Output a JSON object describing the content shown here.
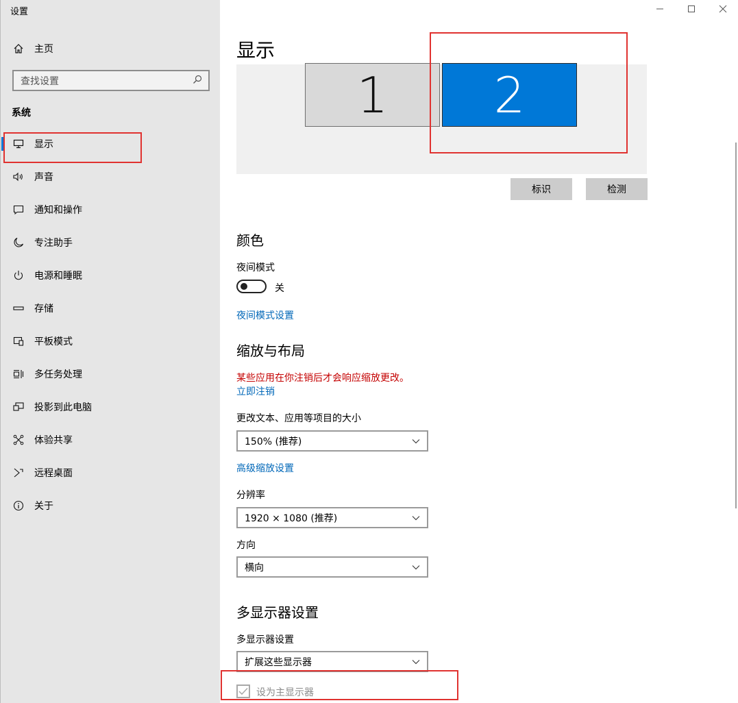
{
  "window": {
    "title": "设置",
    "controls": {
      "minimize": "–",
      "maximize": "☐",
      "close": "✕"
    }
  },
  "sidebar": {
    "home_label": "主页",
    "search_placeholder": "查找设置",
    "section_title": "系统",
    "items": [
      {
        "label": "显示",
        "icon": "monitor-icon",
        "active": true
      },
      {
        "label": "声音",
        "icon": "speaker-icon"
      },
      {
        "label": "通知和操作",
        "icon": "message-icon"
      },
      {
        "label": "专注助手",
        "icon": "moon-icon"
      },
      {
        "label": "电源和睡眠",
        "icon": "power-icon"
      },
      {
        "label": "存储",
        "icon": "storage-icon"
      },
      {
        "label": "平板模式",
        "icon": "tablet-icon"
      },
      {
        "label": "多任务处理",
        "icon": "multitask-icon"
      },
      {
        "label": "投影到此电脑",
        "icon": "project-icon"
      },
      {
        "label": "体验共享",
        "icon": "share-icon"
      },
      {
        "label": "远程桌面",
        "icon": "remote-icon"
      },
      {
        "label": "关于",
        "icon": "info-icon"
      }
    ]
  },
  "main": {
    "title": "显示",
    "monitors": [
      "1",
      "2"
    ],
    "selected_monitor": "2",
    "identify_button": "标识",
    "detect_button": "检测",
    "color_heading": "颜色",
    "night_mode_label": "夜间模式",
    "night_mode_state": "关",
    "night_mode_link": "夜间模式设置",
    "scale_heading": "缩放与布局",
    "scale_warning": "某些应用在你注销后才会响应缩放更改。",
    "sign_out_link": "立即注销",
    "text_size_label": "更改文本、应用等项目的大小",
    "text_size_value": "150% (推荐)",
    "advanced_scaling_link": "高级缩放设置",
    "resolution_label": "分辨率",
    "resolution_value": "1920 × 1080 (推荐)",
    "orientation_label": "方向",
    "orientation_value": "横向",
    "multi_heading": "多显示器设置",
    "multi_label": "多显示器设置",
    "multi_value": "扩展这些显示器",
    "primary_checkbox_label": "设为主显示器",
    "primary_checkbox_checked": true
  },
  "colors": {
    "accent": "#0078d7",
    "link": "#0067b8",
    "warning": "#c40000",
    "annotation": "#e0312f"
  }
}
